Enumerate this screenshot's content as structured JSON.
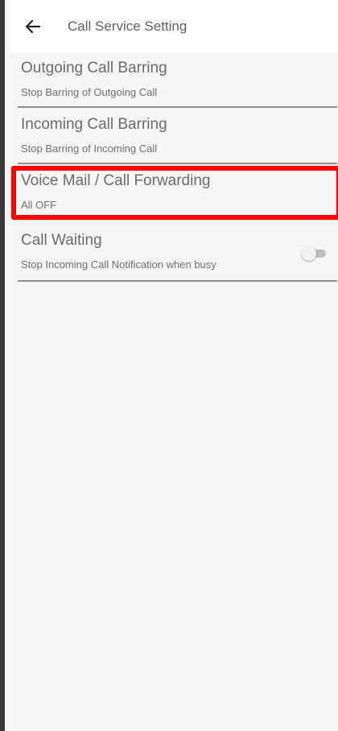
{
  "header": {
    "title": "Call Service Setting",
    "back_icon": "arrow-left-icon"
  },
  "settings": [
    {
      "title": "Outgoing Call Barring",
      "subtitle": "Stop Barring of Outgoing Call"
    },
    {
      "title": "Incoming Call Barring",
      "subtitle": "Stop Barring of Incoming Call"
    },
    {
      "title": "Voice Mail / Call Forwarding",
      "subtitle": "All OFF",
      "highlighted": true
    },
    {
      "title": "Call Waiting",
      "subtitle": "Stop Incoming Call Notification when busy",
      "toggle_on": false
    }
  ],
  "colors": {
    "highlight": "#ff0000",
    "background": "#f6f6f6"
  }
}
